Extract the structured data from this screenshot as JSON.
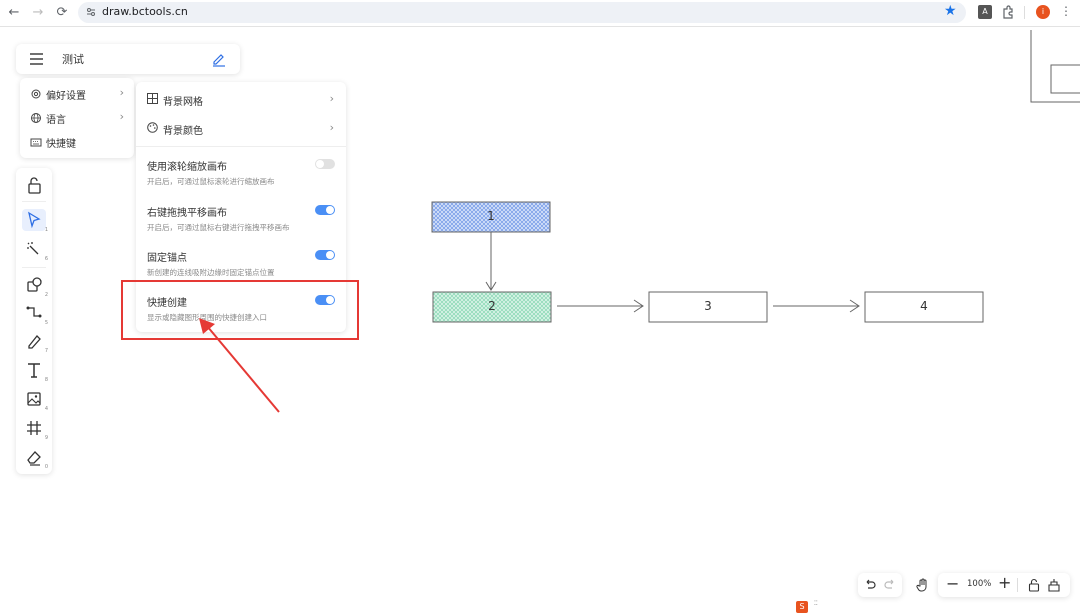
{
  "browser": {
    "url": "draw.bctools.cn",
    "profile_initial": "i",
    "accent_star": "#1a73e8",
    "profile_color": "#e8531f"
  },
  "header": {
    "title": "测试"
  },
  "menu": {
    "items": [
      {
        "label": "偏好设置",
        "icon": "gear-icon",
        "has_submenu": true
      },
      {
        "label": "语言",
        "icon": "globe-icon",
        "has_submenu": true
      },
      {
        "label": "快捷键",
        "icon": "keyboard-icon",
        "has_submenu": false
      }
    ]
  },
  "submenu": {
    "items": [
      {
        "label": "背景网格",
        "icon": "grid-icon"
      },
      {
        "label": "背景颜色",
        "icon": "palette-icon"
      }
    ],
    "settings": [
      {
        "title": "使用滚轮缩放画布",
        "desc": "开启后，可通过鼠标滚轮进行缩放画布",
        "enabled": false
      },
      {
        "title": "右键拖拽平移画布",
        "desc": "开启后，可通过鼠标右键进行拖拽平移画布",
        "enabled": true
      },
      {
        "title": "固定锚点",
        "desc": "新创建的连线吸附边缘时固定锚点位置",
        "enabled": true
      },
      {
        "title": "快捷创建",
        "desc": "显示或隐藏图形周围的快捷创建入口",
        "enabled": true
      }
    ]
  },
  "toolbar": {
    "tools": [
      {
        "name": "lock-icon",
        "key": ""
      },
      {
        "name": "select-arrow-icon",
        "key": "1"
      },
      {
        "name": "magic-select-icon",
        "key": "6"
      },
      {
        "name": "shape-icon",
        "key": "2"
      },
      {
        "name": "connector-icon",
        "key": "5"
      },
      {
        "name": "pen-icon",
        "key": "7"
      },
      {
        "name": "text-icon",
        "key": "8"
      },
      {
        "name": "image-icon",
        "key": "4"
      },
      {
        "name": "frame-icon",
        "key": "9"
      },
      {
        "name": "eraser-icon",
        "key": "0"
      }
    ]
  },
  "canvas": {
    "nodes": [
      {
        "label": "1",
        "fill": "#7b9fe8"
      },
      {
        "label": "2",
        "fill": "#8fd9b8"
      },
      {
        "label": "3",
        "fill": "#ffffff"
      },
      {
        "label": "4",
        "fill": "#ffffff"
      }
    ]
  },
  "zoom": {
    "level": "100%"
  },
  "colors": {
    "highlight": "#e53935",
    "toggle_on": "#4a8ff5",
    "toggle_off": "#e1e1e1"
  }
}
